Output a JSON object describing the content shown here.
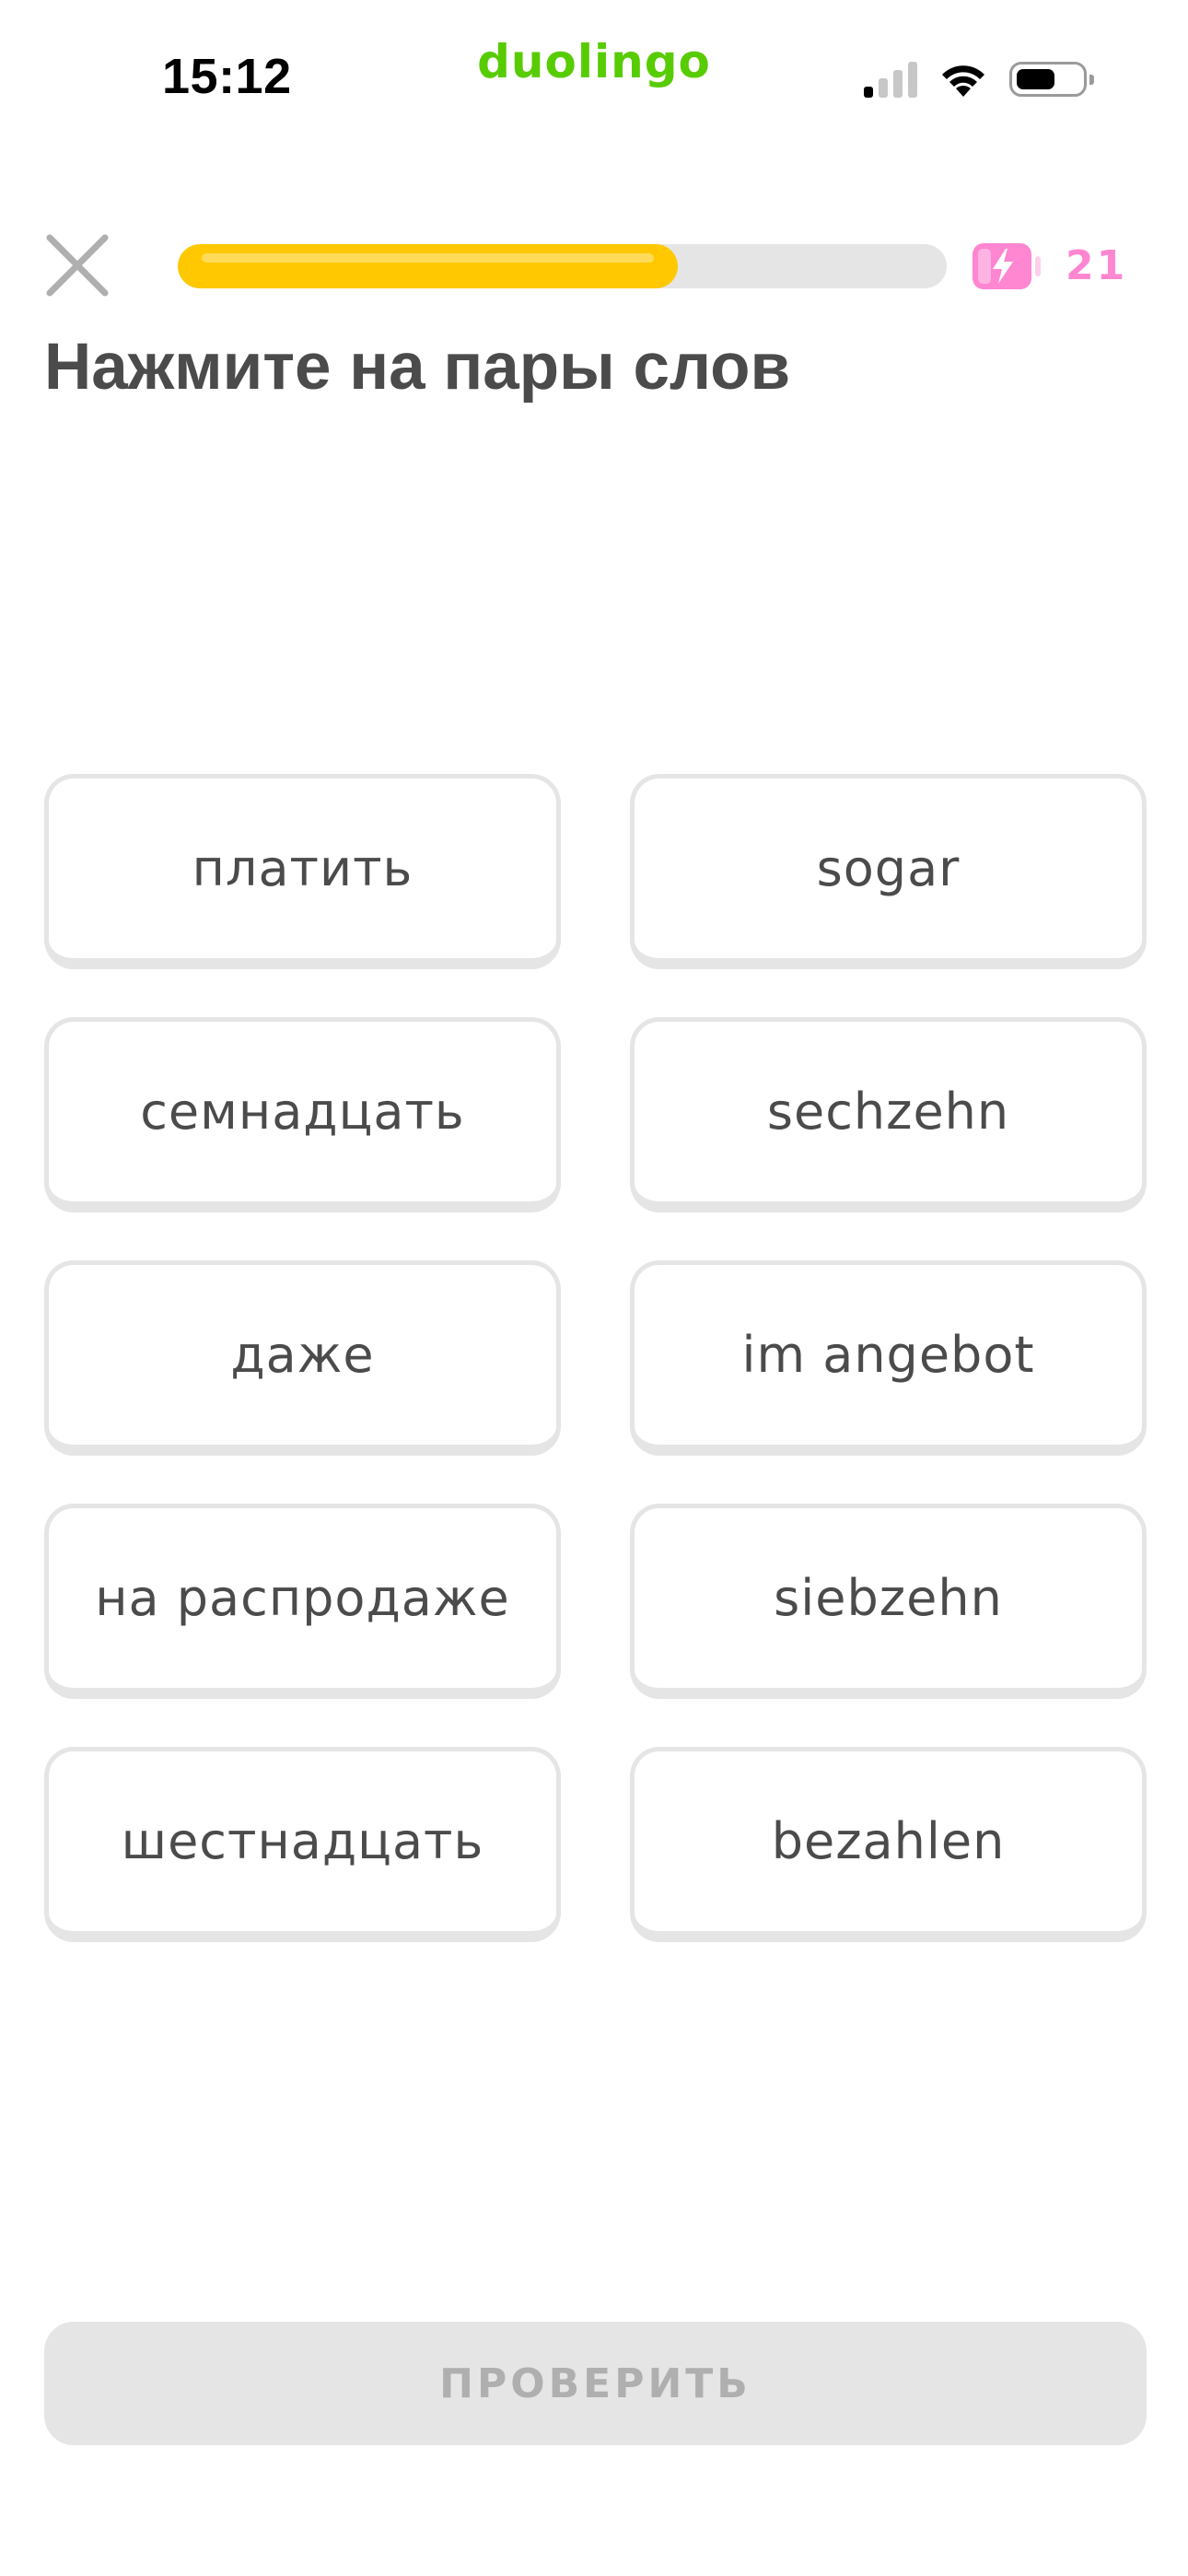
{
  "status_bar": {
    "time": "15:12",
    "brand": "duolingo",
    "signal_bars_active": 1,
    "signal_bars_total": 4,
    "battery_level": 0.6
  },
  "lesson": {
    "progress": 0.65,
    "energy_count": "21",
    "colors": {
      "progress_fill": "#ffc800",
      "progress_track": "#e5e5e5",
      "energy": "#ff86d0",
      "brand": "#58cc02"
    }
  },
  "prompt": {
    "title": "Нажмите на пары слов"
  },
  "tiles": {
    "left": [
      "платить",
      "семнадцать",
      "даже",
      "на распродаже",
      "шестнадцать"
    ],
    "right": [
      "sogar",
      "sechzehn",
      "im angebot",
      "siebzehn",
      "bezahlen"
    ]
  },
  "footer": {
    "check_label": "ПРОВЕРИТЬ",
    "check_enabled": false
  },
  "icons": {
    "close": "close-icon",
    "energy": "energy-battery-icon",
    "signal": "cellular-signal-icon",
    "wifi": "wifi-icon",
    "battery": "battery-icon"
  }
}
